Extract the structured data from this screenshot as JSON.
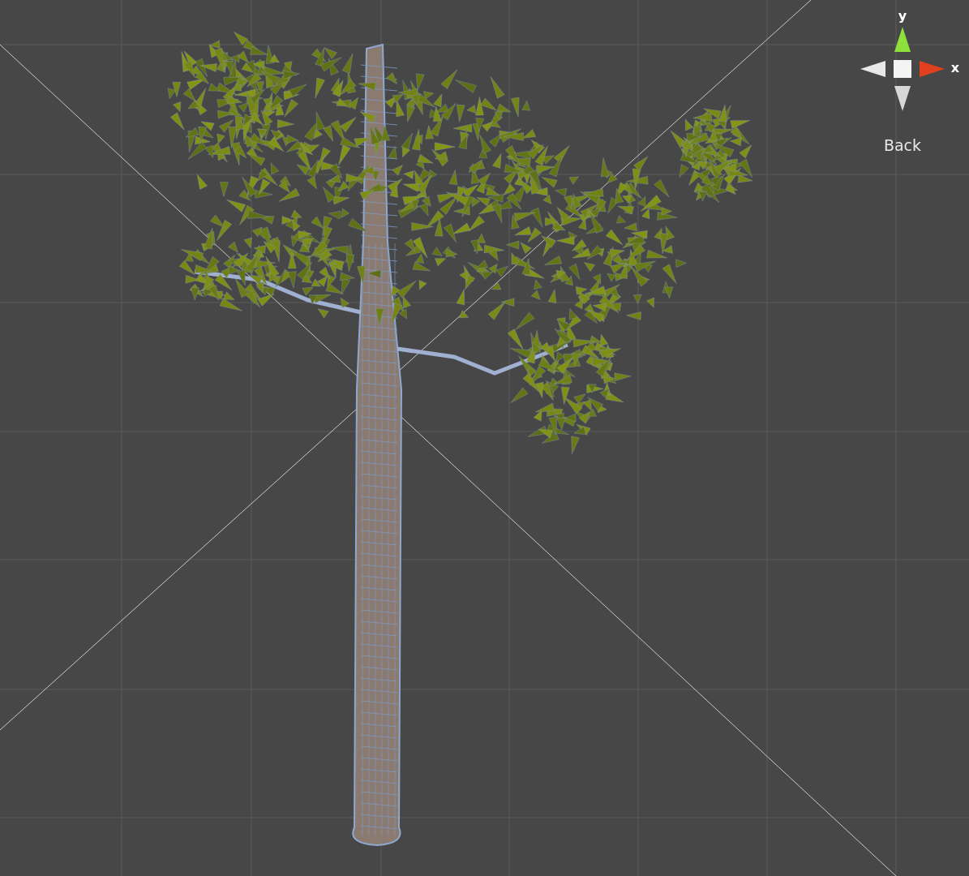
{
  "scene_view": {
    "gizmo": {
      "axis_labels": [
        "y",
        "x"
      ],
      "view_label": "Back"
    }
  }
}
